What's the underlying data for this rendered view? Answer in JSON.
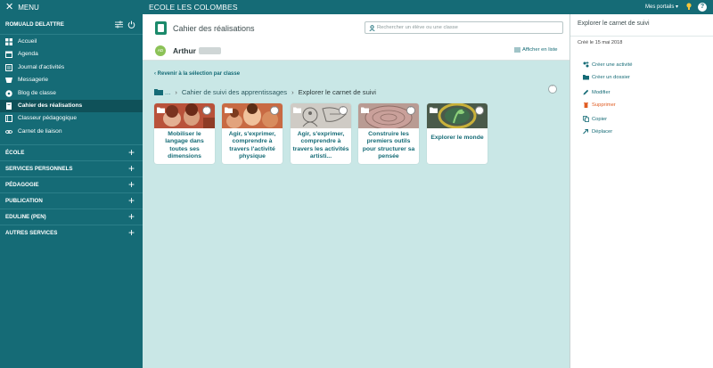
{
  "topbar": {
    "menu_label": "MENU",
    "school_name": "ECOLE LES COLOMBES",
    "portails_label": "Mes portails",
    "help_label": "?"
  },
  "sidebar": {
    "user_name": "ROMUALD DELATTRE",
    "items": [
      {
        "label": "Accueil",
        "icon": "grid-icon"
      },
      {
        "label": "Agenda",
        "icon": "calendar-icon"
      },
      {
        "label": "Journal d'activités",
        "icon": "journal-icon"
      },
      {
        "label": "Messagerie",
        "icon": "messages-icon"
      },
      {
        "label": "Blog de classe",
        "icon": "blog-icon"
      },
      {
        "label": "Cahier des réalisations",
        "icon": "notebook-icon",
        "active": true
      },
      {
        "label": "Classeur pédagogique",
        "icon": "binder-icon"
      },
      {
        "label": "Carnet de liaison",
        "icon": "link-icon"
      }
    ],
    "sections": [
      {
        "label": "ÉCOLE"
      },
      {
        "label": "SERVICES PERSONNELS"
      },
      {
        "label": "PÉDAGOGIE"
      },
      {
        "label": "PUBLICATION"
      },
      {
        "label": "EDULINE (PEN)"
      },
      {
        "label": "AUTRES SERVICES"
      }
    ]
  },
  "header": {
    "title": "Cahier des réalisations",
    "search_placeholder": "Rechercher un élève ou une classe",
    "student_initials": "AD",
    "student_first_name": "Arthur",
    "list_view_label": "Afficher en liste"
  },
  "content": {
    "back_link": "Revenir à la sélection par classe",
    "breadcrumb": {
      "root_dots": "...",
      "items": [
        "Cahier de suivi des apprentissages"
      ],
      "current": "Explorer le carnet de suivi"
    },
    "cards": [
      {
        "title": "Mobiliser le langage dans toutes ses dimensions",
        "theme": "warm"
      },
      {
        "title": "Agir, s'exprimer, comprendre à travers l'activité physique",
        "theme": "warm"
      },
      {
        "title": "Agir, s'exprimer, comprendre à travers les activités artisti...",
        "theme": "grey"
      },
      {
        "title": "Construire les premiers outils pour structurer sa pensée",
        "theme": "pink"
      },
      {
        "title": "Explorer le monde",
        "theme": "green"
      }
    ]
  },
  "right_panel": {
    "title": "Explorer le carnet de suivi",
    "created": "Créé le 15 mai 2018",
    "actions": [
      {
        "label": "Créer une activité",
        "icon": "add-activity-icon"
      },
      {
        "label": "Créer un dossier",
        "icon": "add-folder-icon"
      },
      {
        "label": "Modifier",
        "icon": "edit-icon"
      },
      {
        "label": "Supprimer",
        "icon": "trash-icon",
        "danger": true
      },
      {
        "label": "Copier",
        "icon": "copy-icon"
      },
      {
        "label": "Déplacer",
        "icon": "move-icon"
      }
    ]
  },
  "colors": {
    "brand": "#156b76",
    "sidebar_active": "#0f5159",
    "content_bg": "#c9e7e6",
    "danger": "#e05c22"
  }
}
